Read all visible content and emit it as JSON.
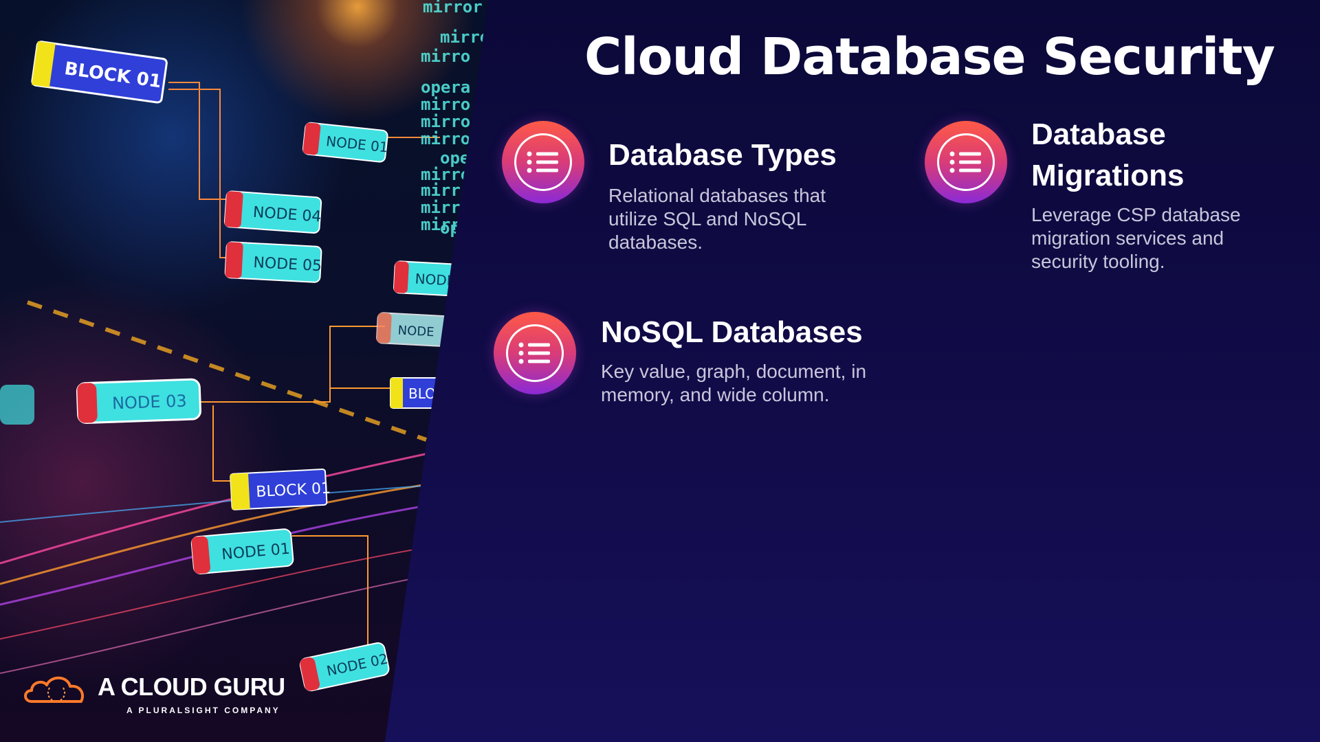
{
  "slide": {
    "title": "Cloud Database Security"
  },
  "features": [
    {
      "title": "Database Types",
      "description": "Relational databases that utilize SQL and NoSQL databases.",
      "icon": "list-icon"
    },
    {
      "title": "Database Migrations",
      "description": "Leverage CSP database migration services and security tooling.",
      "icon": "list-icon"
    },
    {
      "title": "NoSQL Databases",
      "description": "Key value, graph, document, in memory, and wide column.",
      "icon": "list-icon"
    }
  ],
  "logo": {
    "name": "A CLOUD GURU",
    "tagline": "A PLURALSIGHT COMPANY",
    "icon": "cloud-icon"
  },
  "illustration": {
    "labels": [
      "BLOCK 01",
      "NODE 01",
      "NODE 04",
      "NODE 05",
      "NODE 03",
      "BLOCK 01",
      "NODE 01",
      "NODE 02",
      "NODE",
      "NODE",
      "BLOC"
    ],
    "code_text": [
      "mirror",
      "mirro",
      "opera",
      "mirro",
      "mirro",
      "mirro",
      "ope",
      "mirro",
      "mirr",
      "mirr",
      "mirr",
      "mir",
      "op"
    ]
  },
  "colors": {
    "background": "#0c0a35",
    "icon_gradient_top": "#ff5a46",
    "icon_gradient_bottom": "#8b2ad6",
    "node_cyan": "#3fe0e0",
    "node_red": "#e0303c",
    "block_blue": "#2f3fd8",
    "block_yellow": "#f2e21a"
  }
}
